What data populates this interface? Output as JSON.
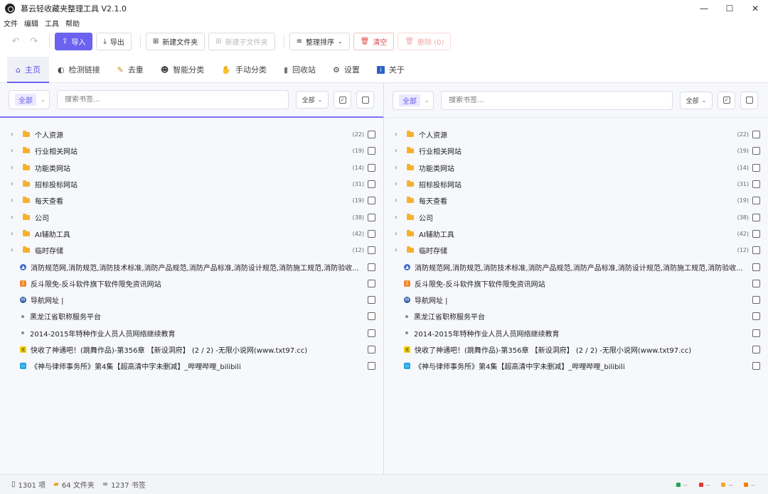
{
  "window": {
    "title": "慕云轻收藏夹整理工具 V2.1.0",
    "controls": {
      "minimize": "—",
      "maximize": "☐",
      "close": "✕"
    }
  },
  "menubar": {
    "items": [
      "文件",
      "编辑",
      "工具",
      "帮助"
    ]
  },
  "toolbar": {
    "undo_icon": "↶",
    "redo_icon": "↷",
    "import_label": "导入",
    "export_label": "导出",
    "new_folder_label": "新建文件夹",
    "new_subfolder_label": "新建子文件夹",
    "sort_label": "整理排序",
    "clear_label": "清空",
    "delete_label": "删除 (0)"
  },
  "tabs": [
    {
      "label": "主页",
      "icon": "home-icon",
      "glyph": "⌂",
      "active": true
    },
    {
      "label": "检测链接",
      "icon": "link-check-icon",
      "glyph": "◐",
      "active": false
    },
    {
      "label": "去重",
      "icon": "broom-icon",
      "glyph": "✎",
      "active": false
    },
    {
      "label": "智能分类",
      "icon": "robot-icon",
      "glyph": "☻",
      "active": false
    },
    {
      "label": "手动分类",
      "icon": "hand-icon",
      "glyph": "✋",
      "active": false
    },
    {
      "label": "回收站",
      "icon": "trash-icon",
      "glyph": "▮",
      "active": false
    },
    {
      "label": "设置",
      "icon": "gear-icon",
      "glyph": "⚙",
      "active": false
    },
    {
      "label": "关于",
      "icon": "info-icon",
      "glyph": "i",
      "active": false
    }
  ],
  "panes": [
    {
      "scope": "全部",
      "search_placeholder": "搜索书签...",
      "type_filter": "全部",
      "folders": [
        {
          "name": "个人资源",
          "count": "(22)"
        },
        {
          "name": "行业相关网站",
          "count": "(19)"
        },
        {
          "name": "功能类网站",
          "count": "(14)"
        },
        {
          "name": "招标投标网站",
          "count": "(31)"
        },
        {
          "name": "每天查看",
          "count": "(19)"
        },
        {
          "name": "公司",
          "count": "(38)"
        },
        {
          "name": "AI辅助工具",
          "count": "(42)"
        },
        {
          "name": "临时存储",
          "count": "(12)"
        }
      ],
      "bookmarks": [
        {
          "title": "消防规范网,消防规范,消防技术标准,消防产品规范,消防产品标准,消防设计规范,消防施工规范,消防验收...",
          "favicon": "tri"
        },
        {
          "title": "反斗限免-反斗软件旗下软件限免资讯网站",
          "favicon": "fd"
        },
        {
          "title": "导航网址 |",
          "favicon": "wp"
        },
        {
          "title": "黑龙江省职称服务平台",
          "favicon": "dot"
        },
        {
          "title": "2014-2015年特种作业人员人员网络继续教育",
          "favicon": "dot"
        },
        {
          "title": "快收了神通吧！(跳舞作品)-第356章 【新设洞府】 (2 / 2) -无限小说网(www.txt97.cc)",
          "favicon": "txt"
        },
        {
          "title": "《神与律师事务所》第4集【超高清中字未删减】_哔哩哔哩_bilibili",
          "favicon": "bili"
        }
      ]
    },
    {
      "scope": "全部",
      "search_placeholder": "搜索书签...",
      "type_filter": "全部",
      "folders": [
        {
          "name": "个人资源",
          "count": "(22)"
        },
        {
          "name": "行业相关网站",
          "count": "(19)"
        },
        {
          "name": "功能类网站",
          "count": "(14)"
        },
        {
          "name": "招标投标网站",
          "count": "(31)"
        },
        {
          "name": "每天查看",
          "count": "(19)"
        },
        {
          "name": "公司",
          "count": "(38)"
        },
        {
          "name": "AI辅助工具",
          "count": "(42)"
        },
        {
          "name": "临时存储",
          "count": "(12)"
        }
      ],
      "bookmarks": [
        {
          "title": "消防规范网,消防规范,消防技术标准,消防产品规范,消防产品标准,消防设计规范,消防施工规范,消防验收...",
          "favicon": "tri"
        },
        {
          "title": "反斗限免-反斗软件旗下软件限免资讯网站",
          "favicon": "fd"
        },
        {
          "title": "导航网址 |",
          "favicon": "wp"
        },
        {
          "title": "黑龙江省职称服务平台",
          "favicon": "dot"
        },
        {
          "title": "2014-2015年特种作业人员人员网络继续教育",
          "favicon": "dot"
        },
        {
          "title": "快收了神通吧！(跳舞作品)-第356章 【新设洞府】 (2 / 2) -无限小说网(www.txt97.cc)",
          "favicon": "txt"
        },
        {
          "title": "《神与律师事务所》第4集【超高清中字未删减】_哔哩哔哩_bilibili",
          "favicon": "bili"
        }
      ]
    }
  ],
  "status": {
    "items_label": "1301 项",
    "folders_label": "64 文件夹",
    "bookmarks_label": "1237 书签",
    "legend": [
      {
        "color": "#1aaa55",
        "text": "--"
      },
      {
        "color": "#e53935",
        "text": "--"
      },
      {
        "color": "#f5a623",
        "text": "--"
      },
      {
        "color": "#f57c00",
        "text": "--"
      }
    ]
  }
}
